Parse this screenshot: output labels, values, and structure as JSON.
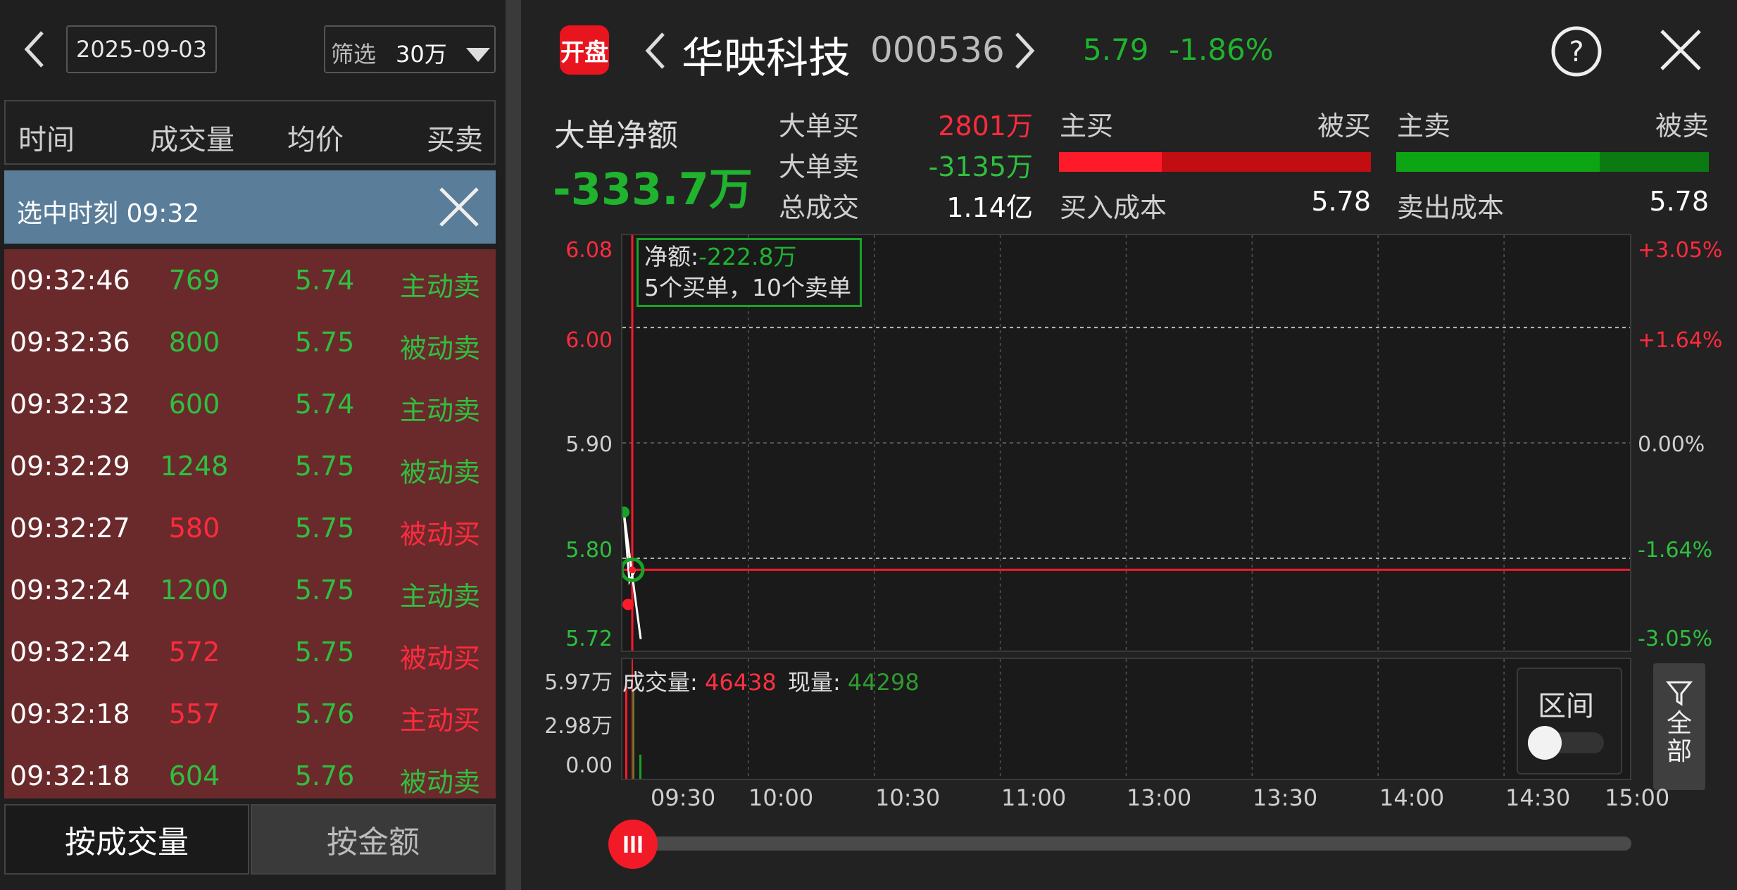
{
  "left_panel": {
    "date": "2025-09-03",
    "filter_label": "筛选",
    "filter_value": "30万",
    "columns": [
      "时间",
      "成交量",
      "均价",
      "买卖"
    ],
    "selected_label": "选中时刻 09:32",
    "trades": [
      {
        "time": "09:32:46",
        "volume": "769",
        "price": "5.74",
        "side": "主动卖",
        "color": "green"
      },
      {
        "time": "09:32:36",
        "volume": "800",
        "price": "5.75",
        "side": "被动卖",
        "color": "green"
      },
      {
        "time": "09:32:32",
        "volume": "600",
        "price": "5.74",
        "side": "主动卖",
        "color": "green"
      },
      {
        "time": "09:32:29",
        "volume": "1248",
        "price": "5.75",
        "side": "被动卖",
        "color": "green"
      },
      {
        "time": "09:32:27",
        "volume": "580",
        "price": "5.75",
        "side": "被动买",
        "color": "red"
      },
      {
        "time": "09:32:24",
        "volume": "1200",
        "price": "5.75",
        "side": "主动卖",
        "color": "green"
      },
      {
        "time": "09:32:24",
        "volume": "572",
        "price": "5.75",
        "side": "被动买",
        "color": "red"
      },
      {
        "time": "09:32:18",
        "volume": "557",
        "price": "5.76",
        "side": "主动买",
        "color": "red"
      },
      {
        "time": "09:32:18",
        "volume": "604",
        "price": "5.76",
        "side": "被动卖",
        "color": "green"
      }
    ],
    "btn_by_volume": "按成交量",
    "btn_by_amount": "按金额"
  },
  "header": {
    "badge": "开盘",
    "stock_name": "华映科技",
    "stock_code": "000536",
    "price": "5.79",
    "change": "-1.86%"
  },
  "summary": {
    "net_label": "大单净额",
    "net_value": "-333.7万",
    "big_buy_label": "大单买",
    "big_buy_value": "2801万",
    "big_sell_label": "大单卖",
    "big_sell_value": "-3135万",
    "total_label": "总成交",
    "total_value": "1.14亿",
    "main_buy": "主买",
    "passive_buy": "被买",
    "main_sell": "主卖",
    "passive_sell": "被卖",
    "buy_cost_label": "买入成本",
    "buy_cost_value": "5.78",
    "sell_cost_label": "卖出成本",
    "sell_cost_value": "5.78",
    "buy_bar_main_fraction": 0.33,
    "sell_bar_main_fraction": 0.65
  },
  "chart": {
    "tooltip_net_label": "净额:",
    "tooltip_net_value": "-222.8万",
    "tooltip_orders": "5个买单，10个卖单",
    "y_left": [
      "6.08",
      "6.00",
      "5.90",
      "5.80",
      "5.72"
    ],
    "y_right": [
      "+3.05%",
      "+1.64%",
      "0.00%",
      "-1.64%",
      "-3.05%"
    ],
    "vol_axis": [
      "5.97万",
      "2.98万",
      "0.00"
    ],
    "vol_label": "成交量:",
    "vol_value": "46438",
    "now_label": "现量:",
    "now_value": "44298",
    "times": [
      "09:30",
      "10:00",
      "10:30",
      "11:00",
      "13:00",
      "13:30",
      "14:00",
      "14:30",
      "15:00"
    ],
    "range_label": "区间",
    "filter_all": "全部"
  },
  "chart_data": {
    "type": "line",
    "y_range": [
      5.72,
      6.08
    ],
    "reference_price": 5.9,
    "current_price": 5.79,
    "x": [
      "09:30",
      "09:31",
      "09:32"
    ],
    "series": [
      {
        "values": [
          5.84,
          5.78,
          5.79
        ]
      }
    ],
    "volume_range": [
      0,
      59700
    ],
    "volume_values": [
      46438,
      44298,
      12000
    ]
  }
}
